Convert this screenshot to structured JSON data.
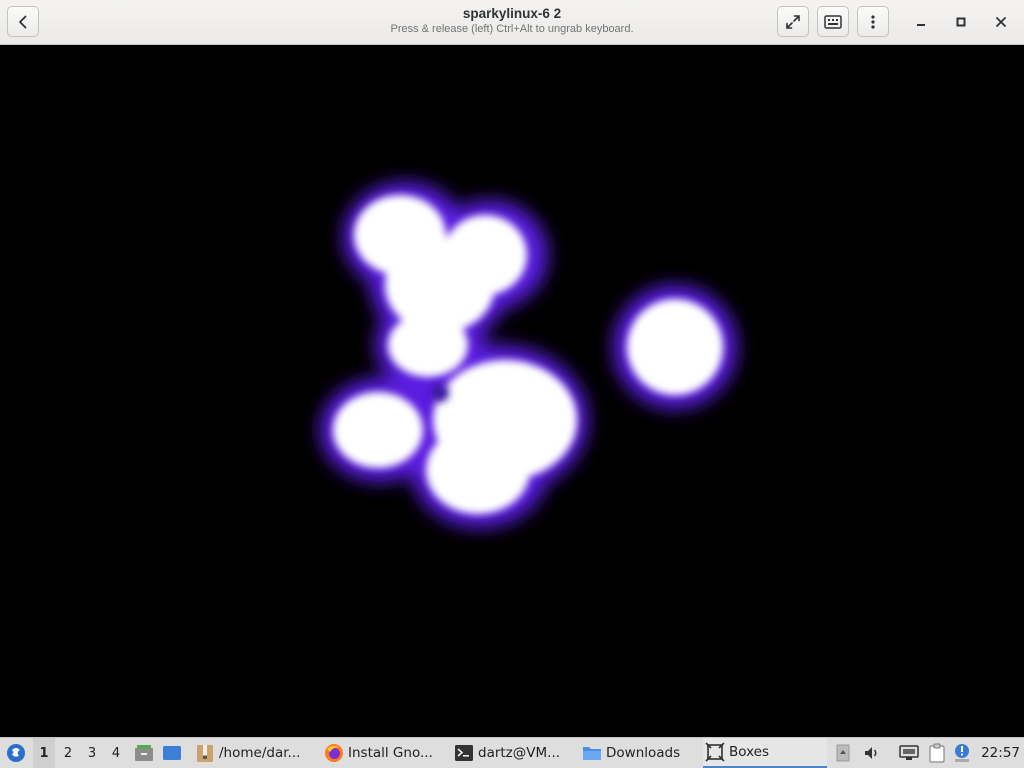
{
  "window": {
    "title": "sparkylinux-6 2",
    "subtitle": "Press & release (left) Ctrl+Alt to ungrab keyboard."
  },
  "header": {
    "left_buttons": [
      "back-icon"
    ],
    "right_buttons": [
      "fullscreen-icon",
      "keyboard-icon",
      "menu-icon"
    ],
    "window_controls": [
      "minimize-icon",
      "maximize-icon",
      "close-icon"
    ]
  },
  "vm_display": {
    "content": "glowing-blobs-screensaver",
    "background": "#000000",
    "glow_color": "#5a1ee0",
    "core_color": "#ffffff"
  },
  "taskbar": {
    "workspaces": [
      {
        "label": "1",
        "active": true
      },
      {
        "label": "2",
        "active": false
      },
      {
        "label": "3",
        "active": false
      },
      {
        "label": "4",
        "active": false
      }
    ],
    "launchers": [
      "menu-logo-icon",
      "file-manager-icon",
      "show-desktop-icon"
    ],
    "tasks": [
      {
        "label": "/home/dar...",
        "icon": "archive-icon",
        "active": false
      },
      {
        "label": "Install Gno...",
        "icon": "firefox-icon",
        "active": false
      },
      {
        "label": "dartz@VM...",
        "icon": "terminal-icon",
        "active": false
      },
      {
        "label": "Downloads",
        "icon": "folder-icon",
        "active": false
      },
      {
        "label": "Boxes",
        "icon": "boxes-icon",
        "active": true
      }
    ],
    "tray": [
      "scroll-up-icon",
      "volume-icon",
      "network-icon",
      "clipboard-icon",
      "updates-icon"
    ],
    "clock": "22:57",
    "accent": "#4a86c7"
  }
}
